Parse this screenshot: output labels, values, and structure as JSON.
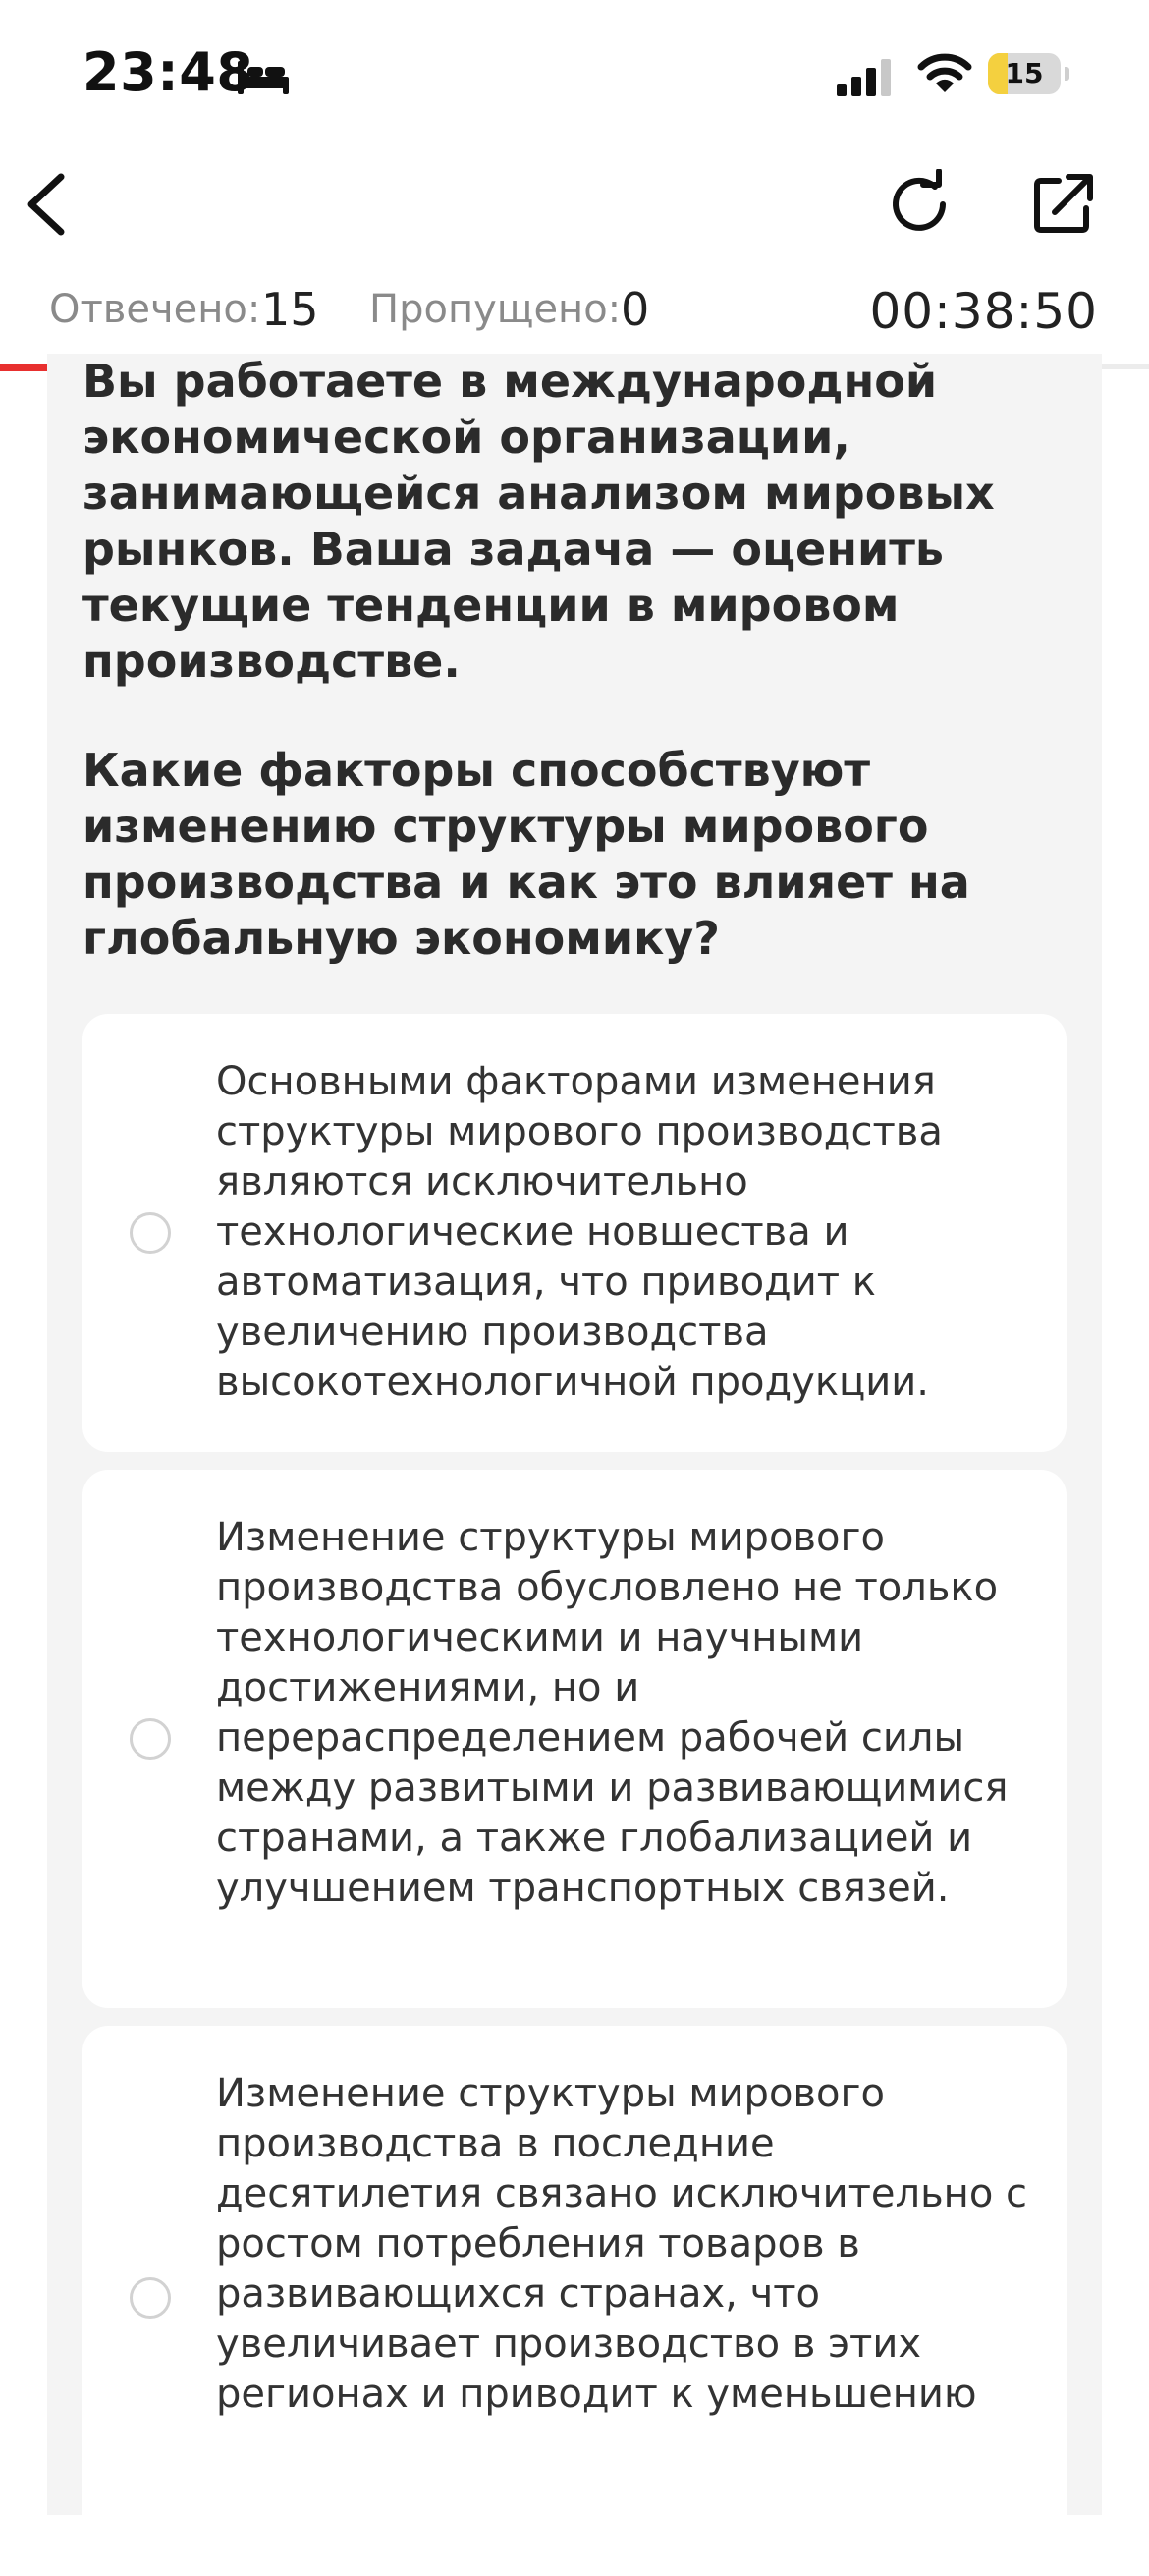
{
  "status_bar": {
    "time": "23:48",
    "battery": "15",
    "icons": [
      "bed-icon",
      "signal-icon",
      "wifi-icon",
      "battery-icon"
    ],
    "battery_color": "#f4d03f"
  },
  "toolbar": {
    "icons": [
      "chevron-left-icon",
      "refresh-icon",
      "share-icon"
    ]
  },
  "stats": {
    "answered_label": "Отвечено:",
    "answered_value": "15",
    "skipped_label": "Пропущено:",
    "skipped_value": "0",
    "timer": "00:38:50",
    "progress_fraction": 0.2,
    "accent_color": "#e8302f"
  },
  "question": {
    "text": "Вы работаете в международной экономической организации, занимающейся анализом мировых рынков. Ваша задача — оценить текущие тенденции в мировом производстве.",
    "prompt": "Какие факторы способствуют изменению структуры мирового производства и как это влияет на глобальную экономику?"
  },
  "options": [
    {
      "text": "Основными факторами изменения структуры мирового производства являются исключительно технологические новшества и автоматизация, что приводит к увеличению производства высокотехнологичной продукции.",
      "selected": false
    },
    {
      "text": "Изменение структуры мирового производства обусловлено не только технологическими и научными достижениями, но и перераспределением рабочей силы между развитыми и развивающимися странами, а также глобализацией и улучшением транспортных связей.",
      "selected": false
    },
    {
      "text": "Изменение структуры мирового производства в последние десятилетия связано исключительно с ростом потребления товаров в развивающихся странах, что увеличивает производство в этих регионах и приводит к уменьшению",
      "selected": false
    }
  ]
}
